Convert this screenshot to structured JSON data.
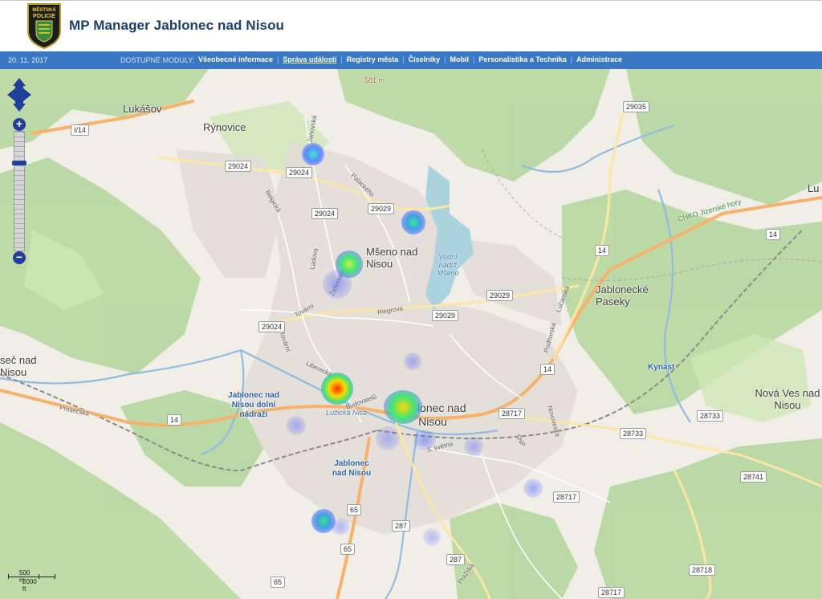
{
  "header": {
    "app_title": "MP Manager Jablonec nad Nisou",
    "logo_text_top": "MĚSTSKÁ",
    "logo_text_bottom": "POLICIE"
  },
  "nav": {
    "date": "20. 11. 2017",
    "modules_label": "DOSTUPNÉ MODULY:",
    "links": [
      {
        "label": "Všeobecné informace",
        "active": false
      },
      {
        "label": "Správa událostí",
        "active": true
      },
      {
        "label": "Registry města",
        "active": false
      },
      {
        "label": "Číselníky",
        "active": false
      },
      {
        "label": "Mobil",
        "active": false
      },
      {
        "label": "Personalistika a Technika",
        "active": false
      },
      {
        "label": "Administrace",
        "active": false
      }
    ]
  },
  "map": {
    "places": {
      "lukasov": "Lukášov",
      "rynovice": "Rýnovice",
      "mseno": "Mšeno nad Nisou",
      "jablonecke_paseky": "Jablonecké Paseky",
      "jablonec": "Jablonec nad Nisou",
      "nova_ves": "Nová Ves nad Nisou",
      "sec": "seč nad Nisou",
      "lu": "Lu"
    },
    "blue_labels": {
      "dolni_nadrazi": "Jablonec nad Nisou dolní nádraží",
      "nadrazi": "Jablonec nad Nisou",
      "kynast": "Kynast"
    },
    "water": {
      "nadrz": "Vodní nádrž Mšeno",
      "luzicka": "Lužická Nisa"
    },
    "elevation": "581 m",
    "chko": "CHKO Jizerské hory",
    "roads": {
      "r29035": "29035",
      "r29024a": "29024",
      "r29024b": "29024",
      "r29024c": "29024",
      "r29024d": "29024",
      "r29029a": "29029",
      "r29029b": "29029",
      "r29029c": "29029",
      "r14a": "14",
      "r14b": "14",
      "r14c": "14",
      "r14d": "14",
      "r28717a": "28717",
      "r28717b": "28717",
      "r28717c": "28717",
      "r28733a": "28733",
      "r28733b": "28733",
      "r28741": "28741",
      "r28718": "28718",
      "r287a": "287",
      "r287b": "287",
      "r65a": "65",
      "r65b": "65",
      "r65c": "65",
      "ri14": "I/14"
    },
    "streets": {
      "janovska": "Janovská",
      "palackeho": "Palackého",
      "belgicka": "Belgická",
      "ladova": "Ladova",
      "zelezna": "Želivského",
      "tovarni_a": "Tovární",
      "tovarni_b": "Tovární",
      "riegrova": "Riegrova",
      "liberecka": "Liberecká",
      "budovatelu": "Budovatelů",
      "prosecska": "Prosečská",
      "lucanska": "Lučanská",
      "podhorska": "Podhorská",
      "novoveska": "Novoveská",
      "snp": "SNP",
      "kvetna": "5. května",
      "prazska": "Pražská"
    },
    "scale": {
      "metric": "500 m",
      "imperial": "2000 ft"
    },
    "controls": {
      "zoom_in": "+",
      "zoom_out": "−"
    }
  },
  "heat_colors": {
    "hot": "#ff2a00",
    "warm": "#ffd800",
    "mid": "#3fe57a",
    "cool": "#5a6cff"
  }
}
